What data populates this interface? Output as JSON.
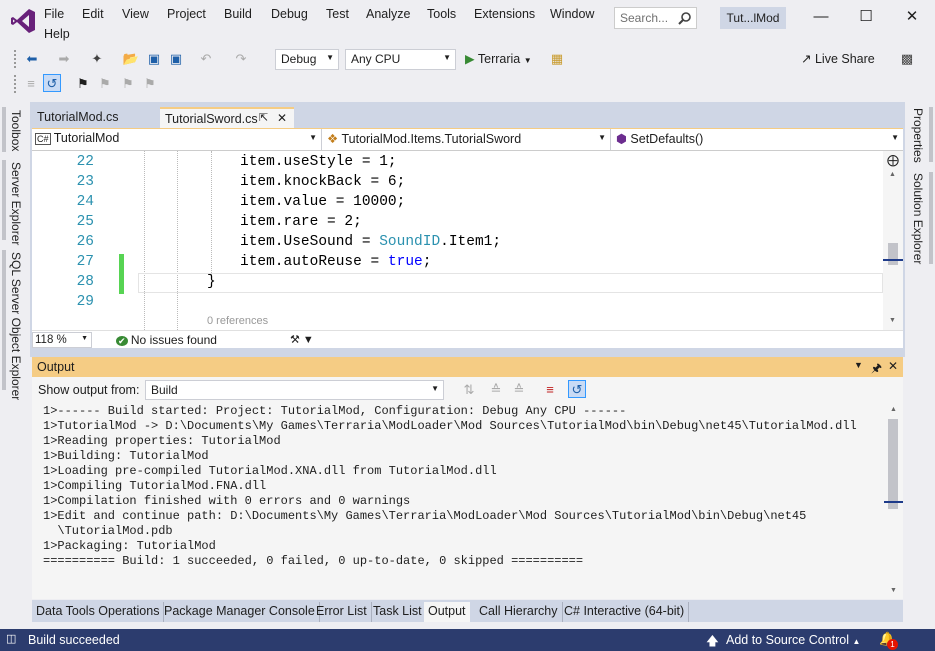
{
  "menu": [
    "File",
    "Edit",
    "View",
    "Project",
    "Build",
    "Debug",
    "Test",
    "Analyze",
    "Tools",
    "Extensions",
    "Window",
    "Help"
  ],
  "search": {
    "placeholder": "Search..."
  },
  "solution_title": "Tut...lMod",
  "toolbar": {
    "config": "Debug",
    "platform": "Any CPU",
    "start_label": "Terraria",
    "live_share": "Live Share"
  },
  "left_tabs": [
    "Toolbox",
    "Server Explorer",
    "SQL Server Object Explorer"
  ],
  "right_tabs": [
    "Properties",
    "Solution Explorer"
  ],
  "doc_tabs": [
    {
      "label": "TutorialMod.cs"
    },
    {
      "label": "TutorialSword.cs"
    }
  ],
  "nav": {
    "project": "TutorialMod",
    "type": "TutorialMod.Items.TutorialSword",
    "member": "SetDefaults()"
  },
  "code": {
    "lines": [
      {
        "num": "22",
        "tokens": [
          {
            "t": "item.useStyle = 1;"
          }
        ]
      },
      {
        "num": "23",
        "tokens": [
          {
            "t": "item.knockBack = 6;"
          }
        ]
      },
      {
        "num": "24",
        "tokens": [
          {
            "t": "item.value = 10000;"
          }
        ]
      },
      {
        "num": "25",
        "tokens": [
          {
            "t": "item.rare = 2;"
          }
        ]
      },
      {
        "num": "26",
        "tokens": [
          {
            "t": "item.UseSound = "
          },
          {
            "t": "SoundID",
            "c": "ty"
          },
          {
            "t": ".Item1;"
          }
        ]
      },
      {
        "num": "27",
        "tokens": [
          {
            "t": "item.autoReuse = "
          },
          {
            "t": "true",
            "c": "kw"
          },
          {
            "t": ";"
          }
        ]
      },
      {
        "num": "28",
        "tokens": [
          {
            "t": "}"
          }
        ]
      },
      {
        "num": "29",
        "tokens": []
      }
    ],
    "references": "0 references"
  },
  "editor_status": {
    "zoom": "118 %",
    "issues": "No issues found"
  },
  "output": {
    "title": "Output",
    "show_from_label": "Show output from:",
    "show_from_value": "Build",
    "lines": [
      "1>------ Build started: Project: TutorialMod, Configuration: Debug Any CPU ------",
      "1>TutorialMod -> D:\\Documents\\My Games\\Terraria\\ModLoader\\Mod Sources\\TutorialMod\\bin\\Debug\\net45\\TutorialMod.dll",
      "1>Reading properties: TutorialMod",
      "1>Building: TutorialMod",
      "1>Loading pre-compiled TutorialMod.XNA.dll from TutorialMod.dll",
      "1>Compiling TutorialMod.FNA.dll",
      "1>Compilation finished with 0 errors and 0 warnings",
      "1>Edit and continue path: D:\\Documents\\My Games\\Terraria\\ModLoader\\Mod Sources\\TutorialMod\\bin\\Debug\\net45",
      "  \\TutorialMod.pdb",
      "1>Packaging: TutorialMod",
      "========== Build: 1 succeeded, 0 failed, 0 up-to-date, 0 skipped =========="
    ]
  },
  "bottom_tabs": [
    "Data Tools Operations",
    "Package Manager Console",
    "Error List",
    "Task List",
    "Output",
    "Call Hierarchy",
    "C# Interactive (64-bit)"
  ],
  "active_bottom_tab": "Output",
  "status": {
    "message": "Build succeeded",
    "source_control": "Add to Source Control",
    "notification_count": "1"
  },
  "colors": {
    "accent": "#68217a",
    "statusbar": "#2c3c6e",
    "output_header": "#f5cc84",
    "tab_active_bg": "#cfd6e5",
    "change_green": "#57d453"
  }
}
